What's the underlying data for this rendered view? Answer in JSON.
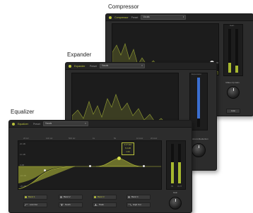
{
  "labels": {
    "compressor": "Compressor",
    "expander": "Expander",
    "equalizer": "Equalizer"
  },
  "compressor": {
    "name": "Compressor",
    "preset_label": "Preset",
    "preset_value": "Vocals",
    "right_label": "Gain",
    "makeup_label": "Make-Up Gain",
    "button_label": "Auto"
  },
  "expander": {
    "name": "Expander",
    "preset_label": "Preset",
    "preset_value": "Vocals",
    "meter_label": "Expansion",
    "knob_label": "Maximum Reduction"
  },
  "equalizer": {
    "name": "Equalizer",
    "preset_label": "Preset",
    "preset_value": "Vocals",
    "tooltip": [
      "3.17 kHz",
      "5.3 dB",
      "1.00"
    ],
    "freq_ticks": [
      "20 Hz",
      "100 Hz",
      "500 Hz",
      "1k",
      "5k",
      "10 kHz",
      "20 kHz"
    ],
    "db_ticks": [
      "20 dB",
      "10 dB",
      "0 dB",
      "-10 dB",
      "-20 dB"
    ],
    "bands": [
      "Band 1",
      "Band 2",
      "Band 3",
      "Band 4"
    ],
    "filters": [
      "Low Cut",
      "Notch",
      "Peak",
      "High Cut"
    ],
    "meter_ticks": [
      "IN",
      "OUT"
    ],
    "gain_label": "Gain"
  },
  "colors": {
    "accent": "#b9c23a",
    "meter_green": "#a7b82f",
    "meter_blue": "#3b6fd1",
    "panel": "#2c2c2c",
    "graph_bg": "#1c1c1c"
  }
}
